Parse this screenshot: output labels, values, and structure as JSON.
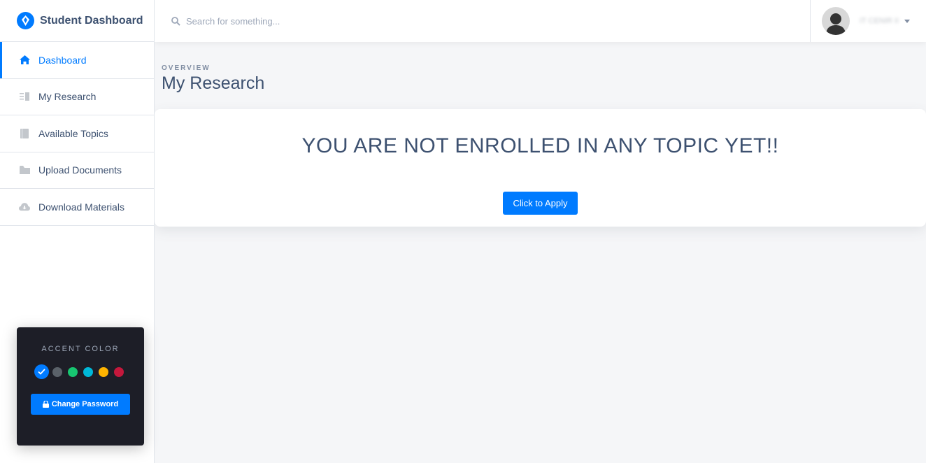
{
  "sidebar": {
    "brand": "Student Dashboard",
    "items": [
      {
        "label": "Dashboard",
        "icon": "home-icon",
        "active": true
      },
      {
        "label": "My Research",
        "icon": "research-icon"
      },
      {
        "label": "Available Topics",
        "icon": "book-icon"
      },
      {
        "label": "Upload Documents",
        "icon": "folder-icon"
      },
      {
        "label": "Download Materials",
        "icon": "cloud-download-icon"
      }
    ]
  },
  "accent_panel": {
    "title": "ACCENT COLOR",
    "colors": [
      "#007bff",
      "#5a6169",
      "#17c671",
      "#00b8d8",
      "#ffb400",
      "#c4183c"
    ],
    "selected": "#007bff",
    "change_password_label": "Change Password"
  },
  "topbar": {
    "search_placeholder": "Search for something...",
    "user_name": "IT CENIR II"
  },
  "main": {
    "overline": "OVERVIEW",
    "title": "My Research",
    "message": "YOU ARE NOT ENROLLED IN ANY TOPIC YET!!",
    "apply_label": "Click to Apply"
  }
}
